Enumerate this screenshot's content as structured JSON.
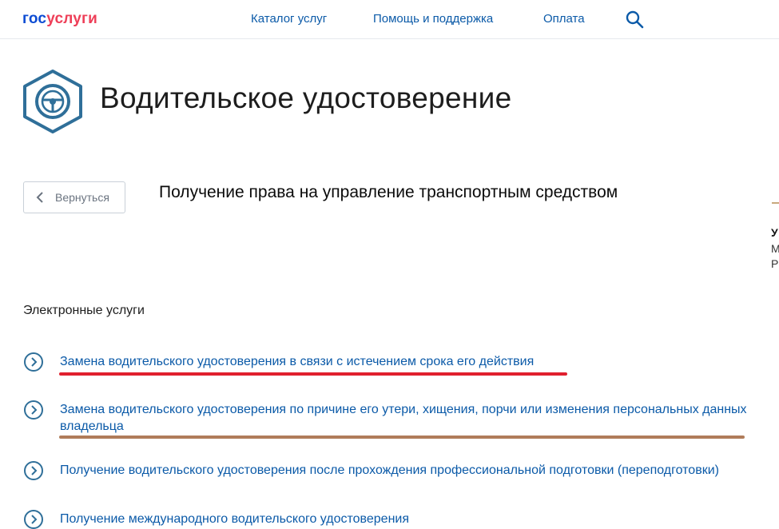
{
  "header": {
    "logo_part1": "гос",
    "logo_part2": "услуги",
    "nav": [
      {
        "label": "Каталог услуг"
      },
      {
        "label": "Помощь и поддержка"
      },
      {
        "label": "Оплата"
      }
    ],
    "search_icon": "search-icon"
  },
  "title": {
    "icon": "steering-wheel-icon",
    "text": "Водительское удостоверение"
  },
  "back_button": {
    "label": "Вернуться",
    "icon": "chevron-left-icon"
  },
  "section_title": "Получение права на управление транспортным средством",
  "edge_fragments": [
    "У",
    "М",
    "Р"
  ],
  "services": {
    "heading": "Электронные услуги",
    "items": [
      {
        "label": "Замена водительского удостоверения в связи с истечением срока его действия"
      },
      {
        "label": "Замена водительского удостоверения по причине его утери, хищения, порчи или изменения персональных данных владельца"
      },
      {
        "label": "Получение водительского удостоверения после прохождения профессиональной подготовки (переподготовки)"
      },
      {
        "label": "Получение международного водительского удостоверения"
      }
    ]
  },
  "colors": {
    "brand_blue": "#0d4cd3",
    "brand_red": "#ee3f58",
    "link_blue": "#0b5aa8",
    "icon_blue": "#2f6f99",
    "underline_red": "#e0202e",
    "underline_brown": "#b07c5a"
  }
}
